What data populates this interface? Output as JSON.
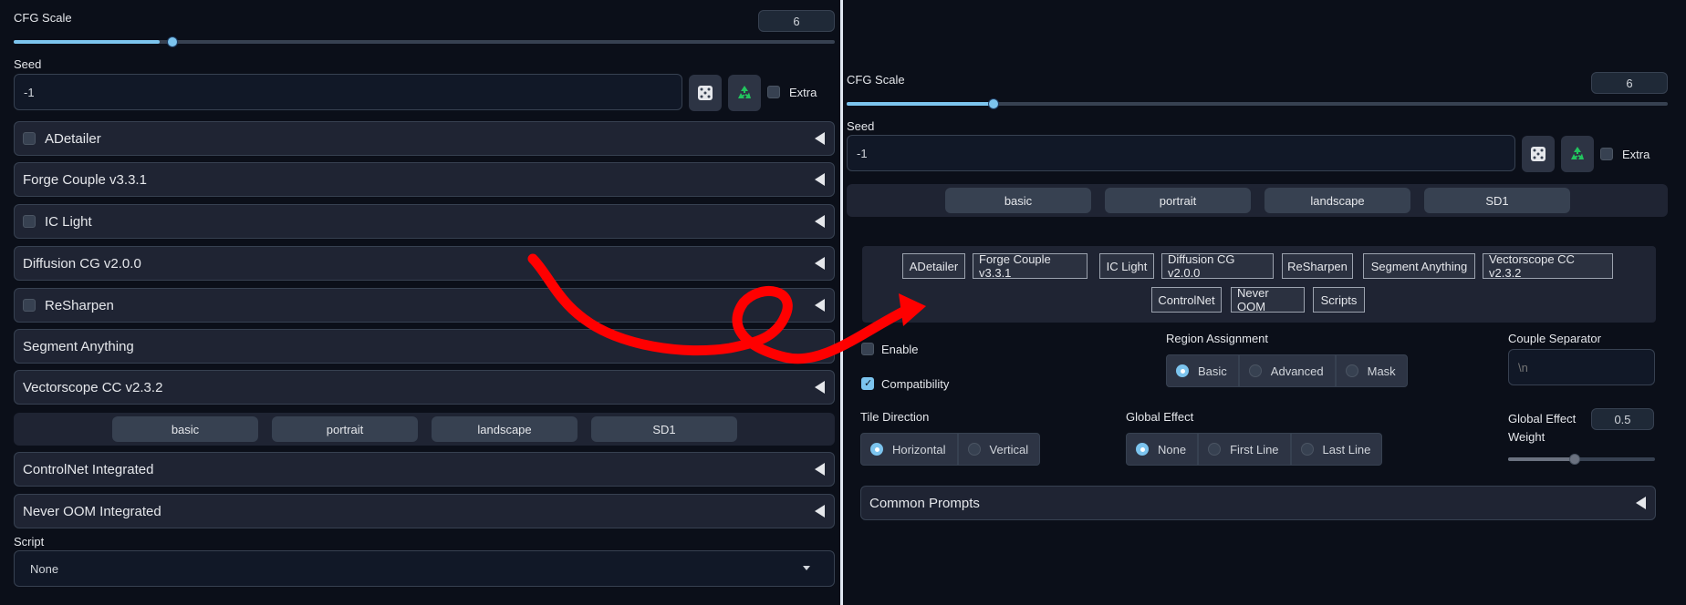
{
  "left": {
    "cfg": {
      "label": "CFG Scale",
      "value": "6",
      "fraction": 0.17
    },
    "seed": {
      "label": "Seed",
      "value": "-1",
      "extra_label": "Extra"
    },
    "accordions": [
      {
        "label": "ADetailer",
        "checkbox": true
      },
      {
        "label": "Forge Couple v3.3.1",
        "checkbox": false
      },
      {
        "label": "IC Light",
        "checkbox": true
      },
      {
        "label": "Diffusion CG v2.0.0",
        "checkbox": false
      },
      {
        "label": "ReSharpen",
        "checkbox": true
      },
      {
        "label": "Segment Anything",
        "checkbox": false
      },
      {
        "label": "Vectorscope CC v2.3.2",
        "checkbox": false
      }
    ],
    "presets": [
      "basic",
      "portrait",
      "landscape",
      "SD1"
    ],
    "accordions2": [
      {
        "label": "ControlNet Integrated"
      },
      {
        "label": "Never OOM Integrated"
      }
    ],
    "script": {
      "label": "Script",
      "value": "None"
    }
  },
  "right": {
    "cfg": {
      "label": "CFG Scale",
      "value": "6",
      "fraction": 0.17
    },
    "seed": {
      "label": "Seed",
      "value": "-1",
      "extra_label": "Extra"
    },
    "presets": [
      "basic",
      "portrait",
      "landscape",
      "SD1"
    ],
    "tabs_row1": [
      "ADetailer",
      "Forge Couple v3.3.1",
      "IC Light",
      "Diffusion CG v2.0.0",
      "ReSharpen",
      "Segment Anything",
      "Vectorscope CC v2.3.2"
    ],
    "tabs_row2": [
      "ControlNet",
      "Never OOM",
      "Scripts"
    ],
    "enable_label": "Enable",
    "compat_label": "Compatibility",
    "region": {
      "label": "Region Assignment",
      "options": [
        "Basic",
        "Advanced",
        "Mask"
      ],
      "selected": "Basic"
    },
    "separator": {
      "label": "Couple Separator",
      "placeholder": "\\n"
    },
    "tile": {
      "label": "Tile Direction",
      "options": [
        "Horizontal",
        "Vertical"
      ],
      "selected": "Horizontal"
    },
    "global_effect": {
      "label": "Global Effect",
      "options": [
        "None",
        "First Line",
        "Last Line"
      ],
      "selected": "None"
    },
    "weight": {
      "label": "Global Effect Weight",
      "value": "0.5",
      "fraction": 0.5
    },
    "common_prompts": "Common Prompts"
  },
  "colors": {
    "accent": "#7cc4ee",
    "background": "#0b0f19",
    "annotation": "#ff0000"
  }
}
